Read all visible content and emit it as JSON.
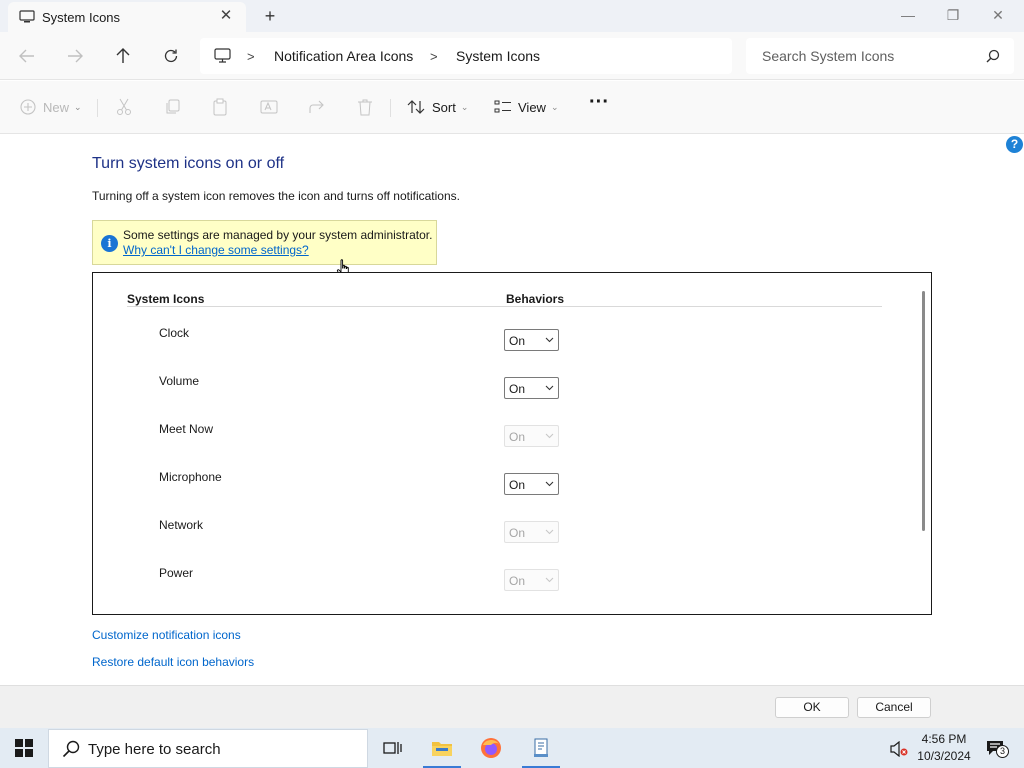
{
  "window": {
    "tab_title": "System Icons",
    "tab_close": "✕",
    "new_tab": "+",
    "minimize": "—",
    "maximize": "❐",
    "close": "✕"
  },
  "address": {
    "breadcrumb": [
      "Notification Area Icons",
      "System Icons"
    ],
    "search_placeholder": "Search System Icons"
  },
  "toolbar": {
    "new_label": "New",
    "sort_label": "Sort",
    "view_label": "View",
    "more_label": "···"
  },
  "content": {
    "title": "Turn system icons on or off",
    "description": "Turning off a system icon removes the icon and turns off notifications.",
    "info_text": "Some settings are managed by your system administrator.",
    "info_link": "Why can't I change some settings?",
    "col_icons": "System Icons",
    "col_behaviors": "Behaviors",
    "rows": [
      {
        "label": "Clock",
        "value": "On",
        "enabled": true
      },
      {
        "label": "Volume",
        "value": "On",
        "enabled": true
      },
      {
        "label": "Meet Now",
        "value": "On",
        "enabled": false
      },
      {
        "label": "Microphone",
        "value": "On",
        "enabled": true
      },
      {
        "label": "Network",
        "value": "On",
        "enabled": false
      },
      {
        "label": "Power",
        "value": "On",
        "enabled": false
      }
    ],
    "link_customize": "Customize notification icons",
    "link_restore": "Restore default icon behaviors",
    "help": "?"
  },
  "footer": {
    "ok_label": "OK",
    "cancel_label": "Cancel"
  },
  "taskbar": {
    "search_placeholder": "Type here to search",
    "time": "4:56 PM",
    "date": "10/3/2024",
    "notification_count": "3"
  },
  "colors": {
    "accent": "#1e82d6",
    "title_blue": "#1e3287",
    "link_blue": "#0066cc",
    "info_bg": "#ffffc6"
  }
}
